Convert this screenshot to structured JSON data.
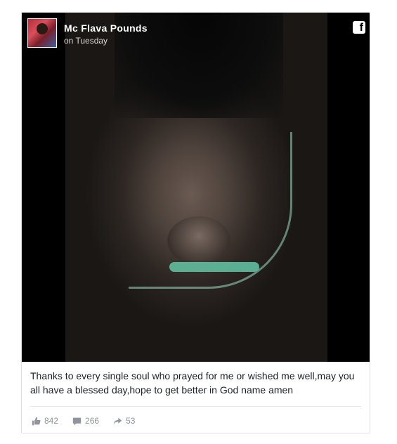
{
  "post": {
    "author": "Mc Flava Pounds",
    "time": "on Tuesday",
    "caption": "Thanks to every single soul who prayed for me or wished me well,may you all have a blessed day,hope to get better in God name amen",
    "platform_icon": "facebook-icon",
    "stats": {
      "likes": "842",
      "comments": "266",
      "shares": "53"
    }
  },
  "icons": {
    "like": "thumbs-up-icon",
    "comment": "comment-bubble-icon",
    "share": "share-arrow-icon"
  },
  "colors": {
    "stat_text": "#90949c",
    "caption_text": "#1d2129",
    "media_bg": "#000000"
  }
}
